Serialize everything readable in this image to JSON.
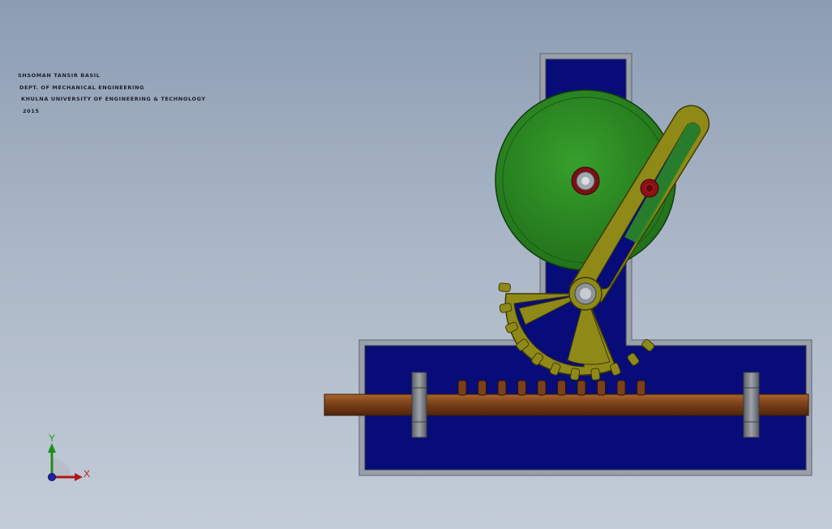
{
  "note": {
    "line1": "SHSOMAN TANSIR BASIL",
    "line2": "DEPT. OF MECHANICAL ENGINEERING",
    "line3": "KHULNA UNIVERSITY OF ENGINEERING & TECHNOLOGY",
    "line4": "2015"
  },
  "triad": {
    "x_label": "X",
    "y_label": "Y"
  },
  "colors": {
    "frame_fill": "#080c78",
    "frame_border": "#8d939e",
    "wheel": "#2c8a23",
    "lever": "#8f8a18",
    "rack_rod": "#76401a",
    "pin": "#8b1116",
    "bearing": "#7f848c"
  }
}
